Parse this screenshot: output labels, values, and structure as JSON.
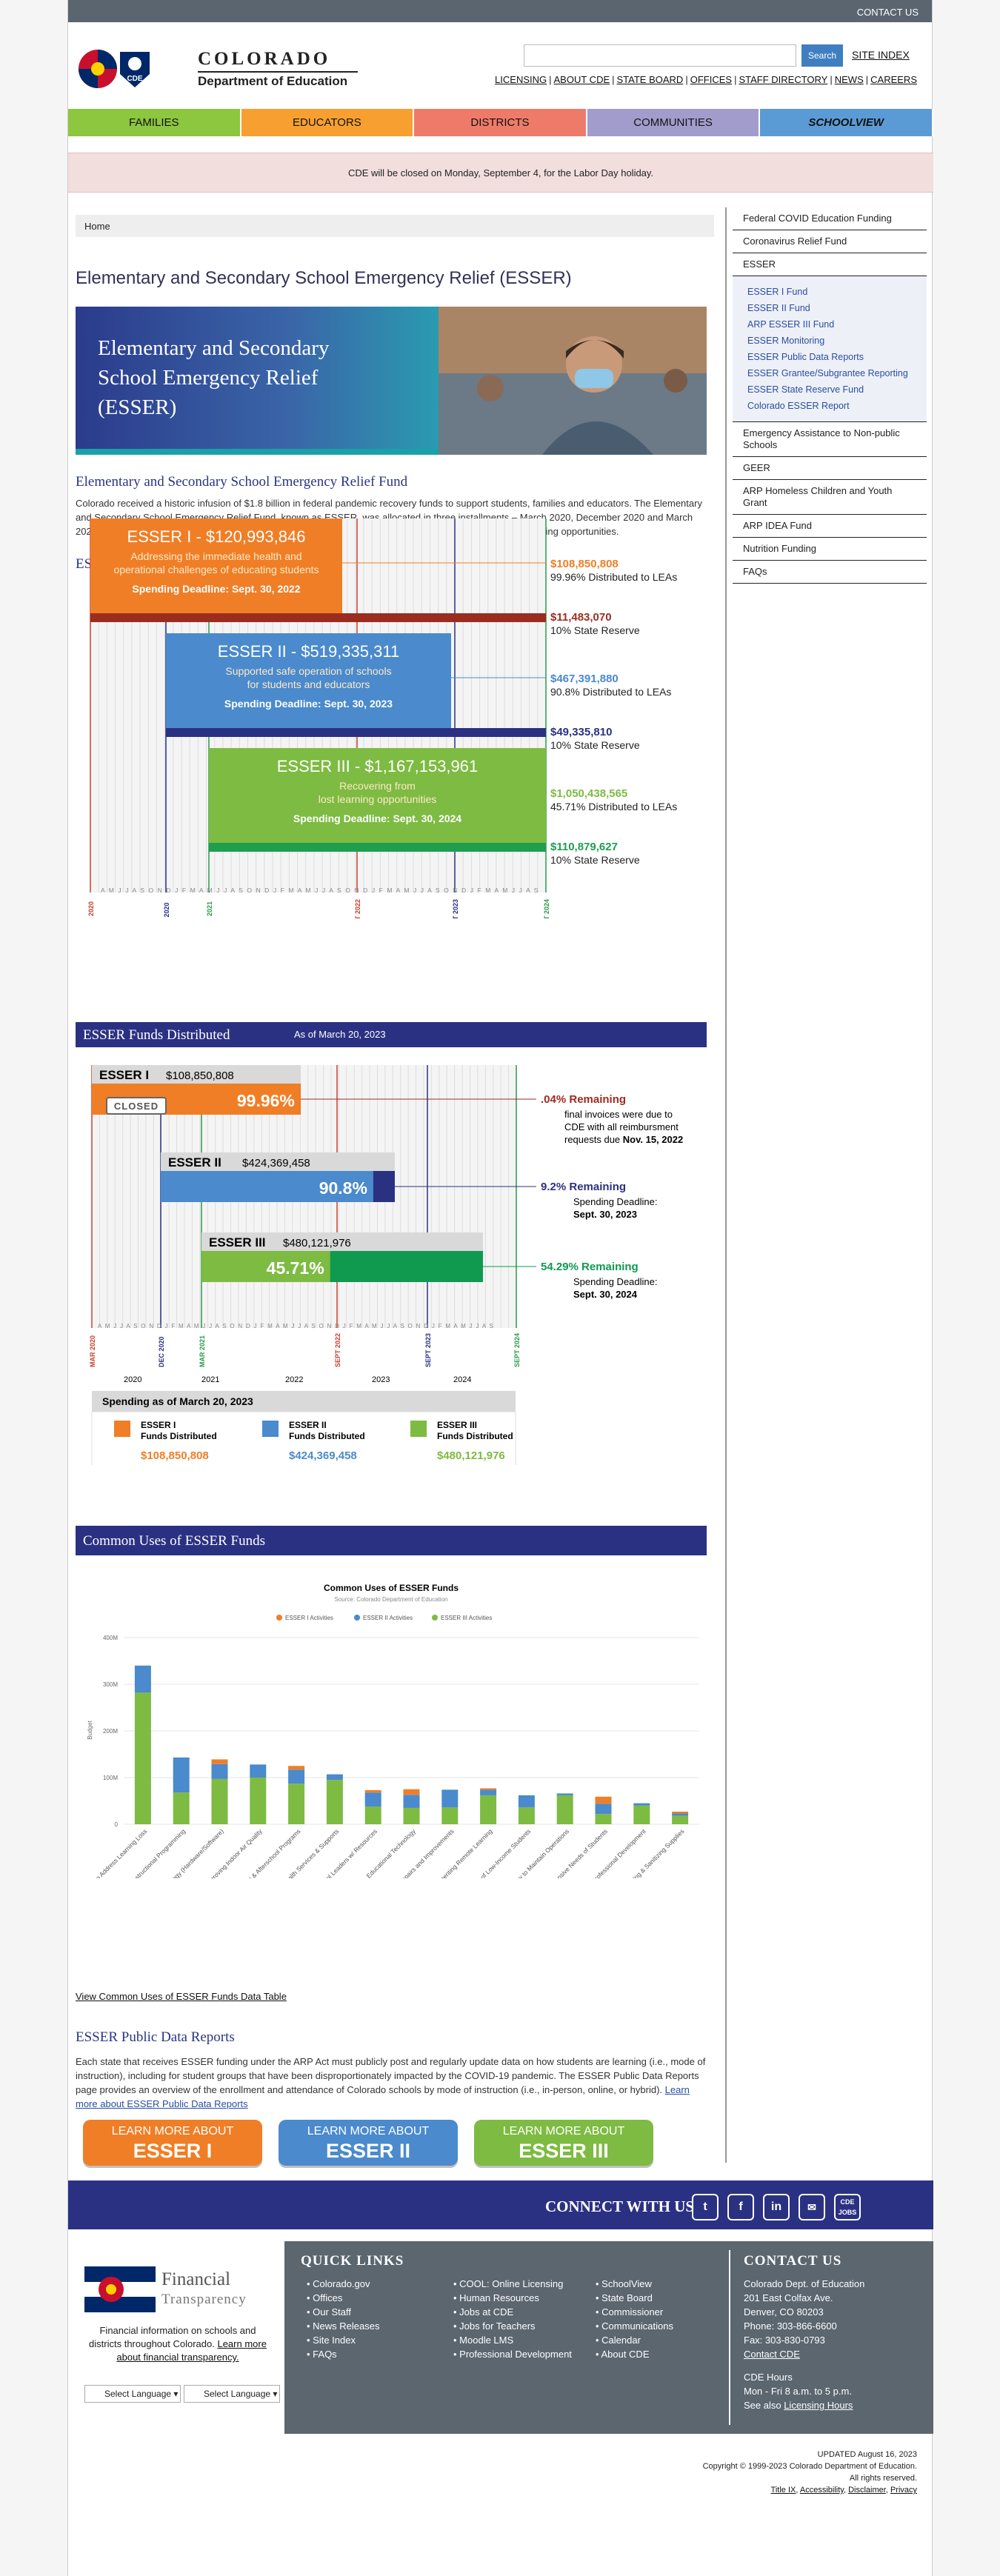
{
  "top": {
    "contact": "CONTACT US"
  },
  "brand": {
    "name": "COLORADO",
    "dept": "Department of Education",
    "seal": "CDE"
  },
  "search": {
    "button": "Search",
    "site_index": "SITE INDEX"
  },
  "utility": [
    "LICENSING",
    "ABOUT CDE",
    "STATE BOARD",
    "OFFICES",
    "STAFF DIRECTORY",
    "NEWS",
    "CAREERS"
  ],
  "nav": [
    {
      "label": "FAMILIES",
      "color": "#8dc63f"
    },
    {
      "label": "EDUCATORS",
      "color": "#f7a031"
    },
    {
      "label": "DISTRICTS",
      "color": "#ee7b6a"
    },
    {
      "label": "COMMUNITIES",
      "color": "#a29ccd"
    },
    {
      "label": "SCHOOLVIEW",
      "color": "#5b9bd5"
    }
  ],
  "alert": "CDE will be closed on Monday, September 4, for the Labor Day holiday.",
  "breadcrumb": "Home",
  "page_title": "Elementary and Secondary School Emergency Relief (ESSER)",
  "hero": {
    "title_l1": "Elementary and Secondary",
    "title_l2": "School Emergency Relief",
    "title_l3": "(ESSER)"
  },
  "fund": {
    "heading": "Elementary and Secondary School Emergency Relief Fund",
    "body": "Colorado received a historic infusion of $1.8 billion in federal pandemic recovery funds to support students, families and educators. The Elementary and Secondary School Emergency Relief Fund, known as ESSER, was allocated in three installments – March 2020, December 2020 and March 2021 and was designed to help schools and communities respond to the pandemic and recover from lost learning opportunities."
  },
  "timeline": {
    "heading": "ESSER I, II & III Funding and Timelines",
    "e1": {
      "title": "ESSER I - $120,993,846",
      "d1": "Addressing the immediate health and",
      "d2": "operational challenges of educating students",
      "deadline": "Spending Deadline: Sept. 30, 2022",
      "leas": "$108,850,808",
      "leas_t": "99.96% Distributed to LEAs",
      "res": "$11,483,070",
      "res_t": "10% State Reserve"
    },
    "e2": {
      "title": "ESSER II - $519,335,311",
      "d1": "Supported safe operation of schools",
      "d2": "for students and educators",
      "deadline": "Spending Deadline: Sept. 30, 2023",
      "leas": "$467,391,880",
      "leas_t": "90.8% Distributed to LEAs",
      "res": "$49,335,810",
      "res_t": "10% State Reserve"
    },
    "e3": {
      "title": "ESSER III - $1,167,153,961",
      "d1": "Recovering from",
      "d2": "lost learning opportunities",
      "deadline": "Spending Deadline: Sept. 30, 2024",
      "leas": "$1,050,438,565",
      "leas_t": "45.71% Distributed to LEAs",
      "res": "$110,879,627",
      "res_t": "10% State Reserve"
    },
    "markers": [
      "MAR 2020",
      "DEC 2020",
      "MAR 2021",
      "SEPT 2022",
      "SEPT 2023",
      "SEPT 2024"
    ],
    "years": [
      "2020",
      "2021",
      "2022",
      "2023",
      "2024"
    ],
    "months": "A M J J A S O N D J F M A M J J A S O N D J F M A M J J A S O N D J F M A M J J A S O N D J F M A M J J A S"
  },
  "distributed": {
    "band": "ESSER Funds Distributed",
    "asof": "As of March 20, 2023",
    "e1": {
      "name": "ESSER I",
      "amt": "$108,850,808",
      "pct": "99.96%",
      "closed": "CLOSED",
      "rem": ".04% Remaining",
      "note1": "final invoices were due to",
      "note2": "CDE with all reimbursment",
      "note3": "requests due",
      "note_date": "Nov. 15, 2022"
    },
    "e2": {
      "name": "ESSER II",
      "amt": "$424,369,458",
      "pct": "90.8%",
      "rem": "9.2% Remaining",
      "note1": "Spending Deadline:",
      "note2": "Sept. 30, 2023"
    },
    "e3": {
      "name": "ESSER III",
      "amt": "$480,121,976",
      "pct": "45.71%",
      "rem": "54.29% Remaining",
      "note1": "Spending Deadline:",
      "note2": "Sept. 30, 2024"
    },
    "summary_title": "Spending as of March 20, 2023",
    "summary": [
      {
        "l1": "ESSER I",
        "l2": "Funds Distributed",
        "amt": "$108,850,808",
        "color": "#f07e26"
      },
      {
        "l1": "ESSER II",
        "l2": "Funds Distributed",
        "amt": "$424,369,458",
        "color": "#4a8acd"
      },
      {
        "l1": "ESSER III",
        "l2": "Funds Distributed",
        "amt": "$480,121,976",
        "color": "#7dbb42"
      }
    ]
  },
  "uses": {
    "band": "Common Uses of ESSER Funds",
    "link": "View Common Uses of ESSER Funds Data Table"
  },
  "chart_data": {
    "type": "bar",
    "title": "Common Uses of ESSER Funds",
    "subtitle": "Source: Colorado Department of Education",
    "ylabel": "Budget",
    "ylim": [
      0,
      400
    ],
    "yticks": [
      "0",
      "100M",
      "200M",
      "300M",
      "400M"
    ],
    "categories": [
      "Activities to Address Learning Loss",
      "Other Instructional Programming",
      "Purchasing Technology (Hardware/Software)",
      "Improving Indoor Air Quality",
      "Summer Learning/Enrichment & Afterschool Programs",
      "Mental Health Services & Supports",
      "Providing Principals & Other School Leaders w/ Resources",
      "Educational Technology",
      "Facility Repairs and Improvements",
      "Planning & Implementing Remote Learning",
      "Addressing Needs of Low-Income Students",
      "Other Activities Necessary to Maintain Operations",
      "Evidence-based Activities to Meet Comprehensive Needs of Students",
      "Training and Professional Development",
      "Cleaning & Sanitizing Supplies"
    ],
    "series": [
      {
        "name": "ESSER I Activities",
        "color": "#f07e26",
        "values": [
          0,
          0,
          10,
          0,
          8,
          0,
          5,
          12,
          0,
          3,
          0,
          0,
          15,
          0,
          4
        ]
      },
      {
        "name": "ESSER II Activities",
        "color": "#4a8acd",
        "values": [
          58,
          75,
          32,
          28,
          30,
          12,
          30,
          28,
          38,
          12,
          26,
          4,
          22,
          5,
          5
        ]
      },
      {
        "name": "ESSER III Activities",
        "color": "#7dbb42",
        "values": [
          282,
          68,
          97,
          100,
          87,
          95,
          38,
          35,
          36,
          62,
          36,
          62,
          22,
          40,
          18
        ]
      }
    ]
  },
  "public_data": {
    "heading": "ESSER Public Data Reports",
    "body": "Each state that receives ESSER funding under the ARP Act must publicly post and regularly update data on how students are learning (i.e., mode of instruction), including for student groups that have been disproportionately impacted by the COVID-19 pandemic. The ESSER Public Data Reports page provides an overview of the enrollment and attendance of Colorado schools by mode of instruction (i.e., in-person, online, or hybrid).",
    "link": "Learn more about ESSER Public Data Reports"
  },
  "buttons": [
    {
      "a": "LEARN MORE ABOUT",
      "b": "ESSER I",
      "color": "#f07e26"
    },
    {
      "a": "LEARN MORE ABOUT",
      "b": "ESSER II",
      "color": "#4a8acd"
    },
    {
      "a": "LEARN MORE ABOUT",
      "b": "ESSER III",
      "color": "#7dbb42"
    }
  ],
  "sidebar": {
    "items_top": [
      "Federal COVID Education Funding",
      "Coronavirus Relief Fund",
      "ESSER"
    ],
    "esser_sub": [
      "ESSER I Fund",
      "ESSER II Fund",
      "ARP ESSER III Fund",
      "ESSER Monitoring",
      "ESSER Public Data Reports",
      "ESSER Grantee/Subgrantee Reporting",
      "ESSER State Reserve Fund",
      "Colorado ESSER Report"
    ],
    "items_bottom": [
      "Emergency Assistance to Non-public Schools",
      "GEER",
      "ARP Homeless Children and Youth Grant",
      "ARP IDEA Fund",
      "Nutrition Funding",
      "FAQs"
    ]
  },
  "connect": {
    "title": "CONNECT WITH US",
    "jobs": "CDE JOBS"
  },
  "footer": {
    "ft_title": "Financial",
    "ft_sub": "Transparency",
    "ft_text": "Financial information on schools and districts throughout Colorado.",
    "ft_link": "Learn more about financial transparency.",
    "lang": "Select Language",
    "quick_title": "QUICK LINKS",
    "col1": [
      "Colorado.gov",
      "Offices",
      "Our Staff",
      "News Releases",
      "Site Index",
      "FAQs"
    ],
    "col2": [
      "COOL: Online Licensing",
      "Human Resources",
      "Jobs at CDE",
      "Jobs for Teachers",
      "Moodle LMS",
      "Professional Development"
    ],
    "col3": [
      "SchoolView",
      "State Board",
      "Commissioner",
      "Communications",
      "Calendar",
      "About CDE"
    ],
    "contact_title": "CONTACT US",
    "contact": [
      "Colorado Dept. of Education",
      "201 East Colfax Ave.",
      "Denver, CO 80203",
      "Phone: 303-866-6600",
      "Fax: 303-830-0793"
    ],
    "contact_link": "Contact CDE",
    "hours_title": "CDE Hours",
    "hours": "Mon - Fri 8 a.m. to 5 p.m.",
    "hours_see": "See also",
    "hours_link": "Licensing Hours"
  },
  "bottom": {
    "updated": "UPDATED August 16, 2023",
    "copy": "Copyright © 1999-2023 Colorado Department of Education.",
    "rights": "All rights reserved.",
    "links": [
      "Title IX",
      "Accessibility",
      "Disclaimer",
      "Privacy"
    ]
  }
}
